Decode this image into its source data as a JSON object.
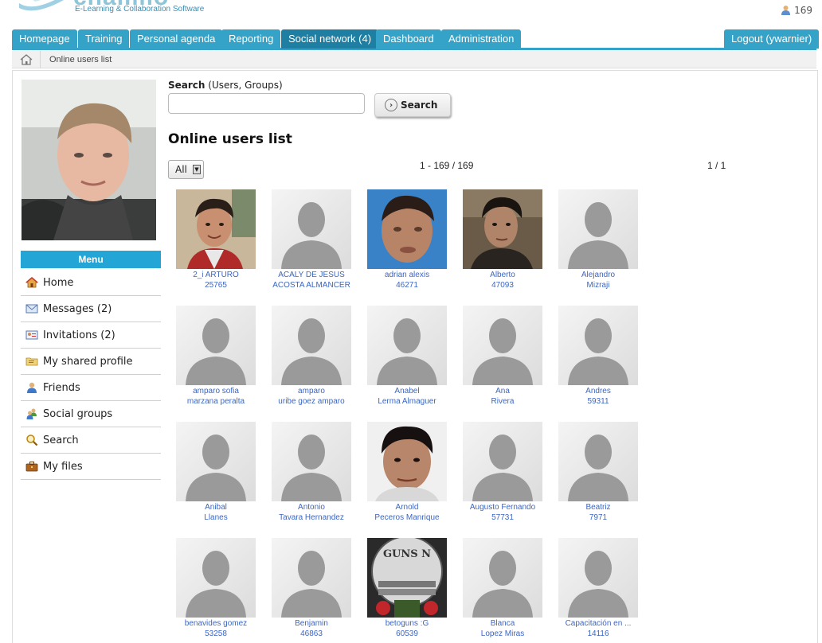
{
  "header": {
    "logo_text": "chamilo",
    "logo_tagline": "E-Learning & Collaboration Software",
    "online_count": "169"
  },
  "tabs": [
    {
      "label": "Homepage"
    },
    {
      "label": "Training"
    },
    {
      "label": "Personal agenda"
    },
    {
      "label": "Reporting"
    },
    {
      "label": "Social network (4)",
      "active": true
    },
    {
      "label": "Dashboard"
    },
    {
      "label": "Administration"
    }
  ],
  "logout_label": "Logout (ywarnier)",
  "breadcrumb": {
    "current": "Online users list"
  },
  "menu": {
    "title": "Menu",
    "items": [
      {
        "label": "Home",
        "icon": "home-icon"
      },
      {
        "label": "Messages (2)",
        "icon": "envelope-icon"
      },
      {
        "label": "Invitations (2)",
        "icon": "invitation-icon"
      },
      {
        "label": "My shared profile",
        "icon": "folder-icon"
      },
      {
        "label": "Friends",
        "icon": "user-icon"
      },
      {
        "label": "Social groups",
        "icon": "group-icon"
      },
      {
        "label": "Search",
        "icon": "magnifier-icon"
      },
      {
        "label": "My files",
        "icon": "briefcase-icon"
      }
    ]
  },
  "search": {
    "label_bold": "Search",
    "label_rest": " (Users, Groups)",
    "value": "",
    "button_label": "Search"
  },
  "page_title": "Online users list",
  "filter": {
    "selected": "All"
  },
  "pagination": {
    "range": "1 - 169 / 169",
    "page": "1 / 1"
  },
  "users": [
    {
      "line1": "2_i ARTURO",
      "line2": "25765",
      "photo": "boy"
    },
    {
      "line1": "ACALY DE JESUS",
      "line2": "ACOSTA ALMANCER",
      "photo": "placeholder"
    },
    {
      "line1": "adrian alexis",
      "line2": "46271",
      "photo": "blur"
    },
    {
      "line1": "Alberto",
      "line2": "47093",
      "photo": "man"
    },
    {
      "line1": "Alejandro",
      "line2": "Mizraji",
      "photo": "placeholder"
    },
    {
      "line1": "amparo sofia",
      "line2": "marzana peralta",
      "photo": "placeholder"
    },
    {
      "line1": "amparo",
      "line2": "uribe goez amparo",
      "photo": "placeholder"
    },
    {
      "line1": "Anabel",
      "line2": "Lerma Almaguer",
      "photo": "placeholder"
    },
    {
      "line1": "Ana",
      "line2": "Rivera",
      "photo": "placeholder"
    },
    {
      "line1": "Andres",
      "line2": "59311",
      "photo": "placeholder"
    },
    {
      "line1": "Anibal",
      "line2": "Llanes",
      "photo": "placeholder"
    },
    {
      "line1": "Antonio",
      "line2": "Tavara Hernandez",
      "photo": "placeholder"
    },
    {
      "line1": "Arnold",
      "line2": "Peceros Manrique",
      "photo": "face"
    },
    {
      "line1": "Augusto Fernando",
      "line2": "57731",
      "photo": "placeholder"
    },
    {
      "line1": "Beatriz",
      "line2": "7971",
      "photo": "placeholder"
    },
    {
      "line1": "benavides gomez",
      "line2": "53258",
      "photo": "placeholder"
    },
    {
      "line1": "Benjamin",
      "line2": "46863",
      "photo": "placeholder"
    },
    {
      "line1": "betoguns :G",
      "line2": "60539",
      "photo": "guns"
    },
    {
      "line1": "Blanca",
      "line2": "Lopez Miras",
      "photo": "placeholder"
    },
    {
      "line1": "Capacitación en ...",
      "line2": "14116",
      "photo": "placeholder"
    }
  ],
  "colors": {
    "tab": "#35a3c8",
    "tab_active": "#1f7fa3",
    "link": "#3b66c4",
    "menu_head": "#23a6d5"
  }
}
